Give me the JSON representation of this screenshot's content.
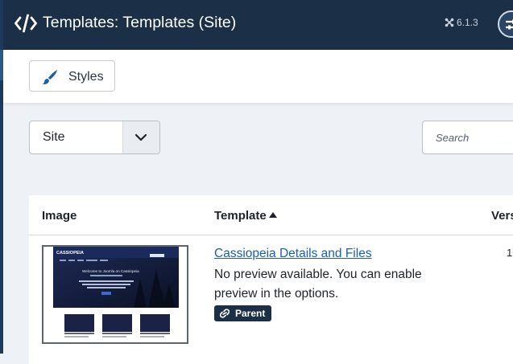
{
  "header": {
    "title": "Templates: Templates (Site)",
    "version": "6.1.3"
  },
  "toolbar": {
    "styles_label": "Styles"
  },
  "filters": {
    "client_selected": "Site",
    "search_placeholder": "Search"
  },
  "table": {
    "columns": {
      "image": "Image",
      "template": "Template",
      "version": "Vers"
    },
    "rows": [
      {
        "name": "Cassiopeia Details and Files",
        "note": "No preview available. You can enable preview in the options.",
        "badge": "Parent",
        "version": "1",
        "thumbnail": {
          "brand": "CASSIOPEIA",
          "hero_text": "Welcome to Joomla on Cassiopeia"
        }
      }
    ]
  },
  "colors": {
    "header_bg": "#1b2f47",
    "link": "#1a5fa8",
    "badge_bg": "#1b2f47",
    "page_bg": "#eef1f6"
  }
}
